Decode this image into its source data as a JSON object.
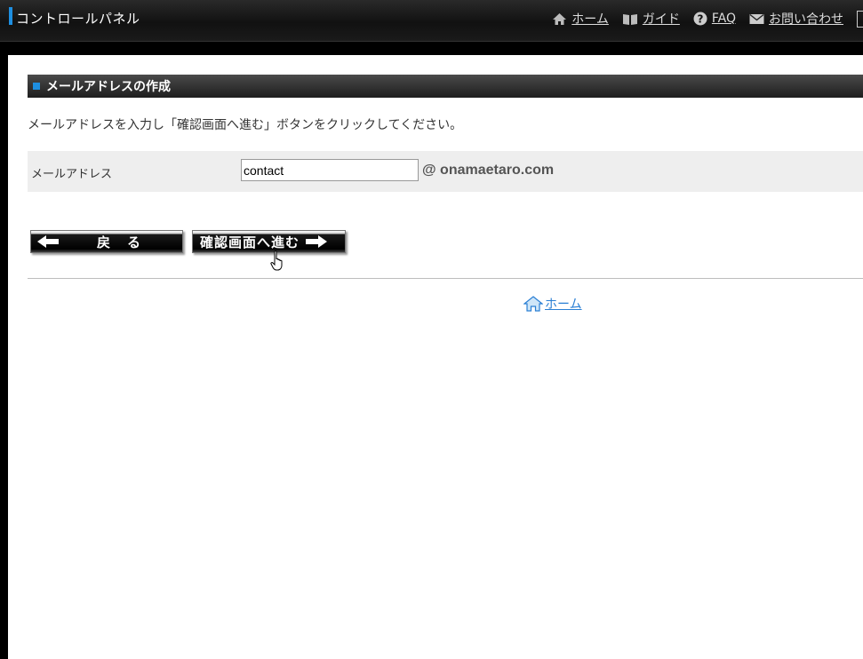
{
  "header": {
    "title": "コントロールパネル",
    "nav": {
      "home": "ホーム",
      "guide": "ガイド",
      "faq": "FAQ",
      "contact": "お問い合わせ"
    },
    "accent_color": "#1e8fe1"
  },
  "section": {
    "title": "メールアドレスの作成"
  },
  "instruction": "メールアドレスを入力し「確認画面へ進む」ボタンをクリックしてください。",
  "form": {
    "email_label": "メールアドレス",
    "email_value": "contact",
    "domain": "@ onamaetaro.com"
  },
  "buttons": {
    "back": "戻　る",
    "next": "確認画面へ進む"
  },
  "footer": {
    "home_link": "ホーム"
  },
  "icons": [
    "home-icon",
    "book-icon",
    "help-icon",
    "mail-icon",
    "arrow-left-icon",
    "arrow-right-icon",
    "hand-cursor-icon"
  ]
}
